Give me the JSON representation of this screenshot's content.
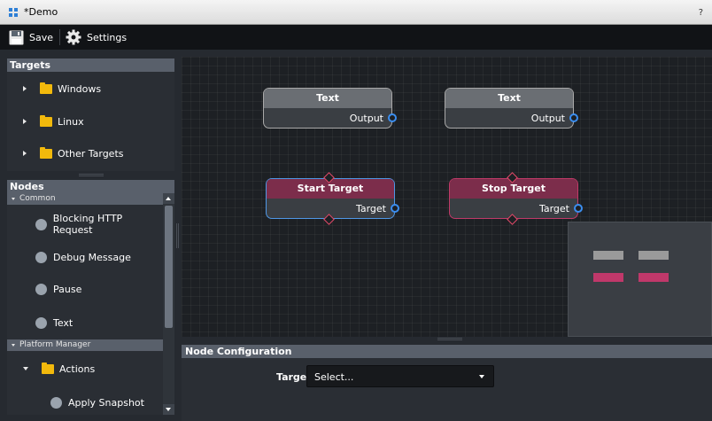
{
  "window": {
    "title": "*Demo",
    "help": "?"
  },
  "toolbar": {
    "save_label": "Save",
    "settings_label": "Settings"
  },
  "targets": {
    "header": "Targets",
    "items": [
      {
        "label": "Windows"
      },
      {
        "label": "Linux"
      },
      {
        "label": "Other Targets"
      }
    ]
  },
  "nodes": {
    "header": "Nodes",
    "common": {
      "label": "Common",
      "items": [
        {
          "label": "Blocking HTTP Request"
        },
        {
          "label": "Debug Message"
        },
        {
          "label": "Pause"
        },
        {
          "label": "Text"
        }
      ]
    },
    "platform_manager": {
      "label": "Platform Manager",
      "actions": {
        "label": "Actions"
      },
      "items": [
        {
          "label": "Apply Snapshot"
        }
      ]
    }
  },
  "graph": {
    "nodes": [
      {
        "title": "Text",
        "port": "Output"
      },
      {
        "title": "Text",
        "port": "Output"
      },
      {
        "title": "Start Target",
        "port": "Target"
      },
      {
        "title": "Stop Target",
        "port": "Target"
      }
    ]
  },
  "config": {
    "header": "Node Configuration",
    "target_label": "Target",
    "target_value": "Select..."
  },
  "colors": {
    "panel_header": "#59606b",
    "canvas_bg": "#1d2024",
    "port_blue": "#3b8ef0",
    "target_node": "#7c2d4b",
    "folder": "#f2b90c"
  }
}
